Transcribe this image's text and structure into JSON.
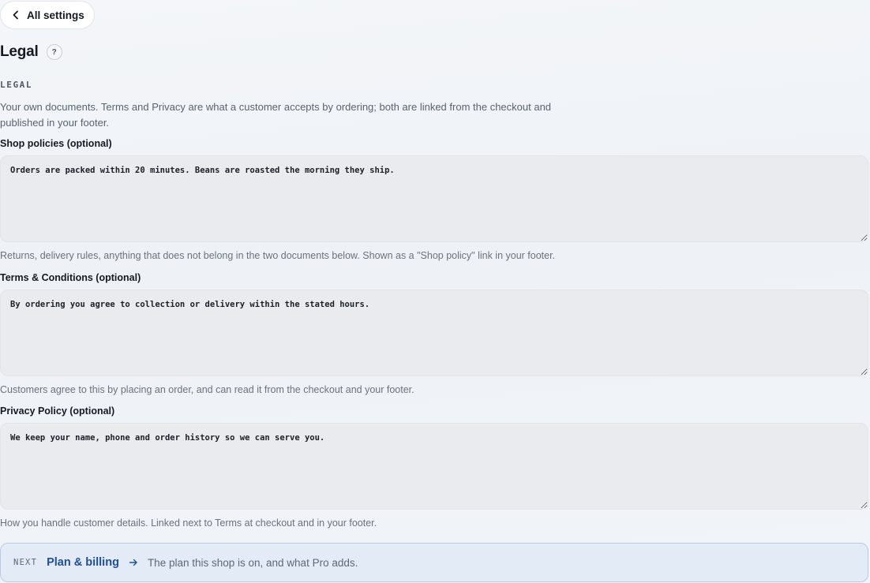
{
  "nav": {
    "back_label": "All settings"
  },
  "page": {
    "title": "Legal",
    "help_glyph": "?"
  },
  "section": {
    "label": "LEGAL",
    "description": "Your own documents. Terms and Privacy are what a customer accepts by ordering; both are linked from the checkout and published in your footer."
  },
  "fields": [
    {
      "label": "Shop policies (optional)",
      "value": "Orders are packed within 20 minutes. Beans are roasted the morning they ship.",
      "hint": "Returns, delivery rules, anything that does not belong in the two documents below. Shown as a \"Shop policy\" link in your footer."
    },
    {
      "label": "Terms & Conditions (optional)",
      "value": "By ordering you agree to collection or delivery within the stated hours.",
      "hint": "Customers agree to this by placing an order, and can read it from the checkout and your footer."
    },
    {
      "label": "Privacy Policy (optional)",
      "value": "We keep your name, phone and order history so we can serve you.",
      "hint": "How you handle customer details. Linked next to Terms at checkout and in your footer."
    }
  ],
  "next": {
    "tag": "NEXT",
    "title": "Plan & billing",
    "description": "The plan this shop is on, and what Pro adds."
  },
  "icons": {
    "back": "chevron-left-icon",
    "help": "question-icon",
    "next": "arrow-right-icon"
  },
  "colors": {
    "accent": "#1f4f99",
    "next_card_bg": "#e3ebf6",
    "next_card_border": "#b9cbe4",
    "textarea_bg": "#e9ebee"
  }
}
